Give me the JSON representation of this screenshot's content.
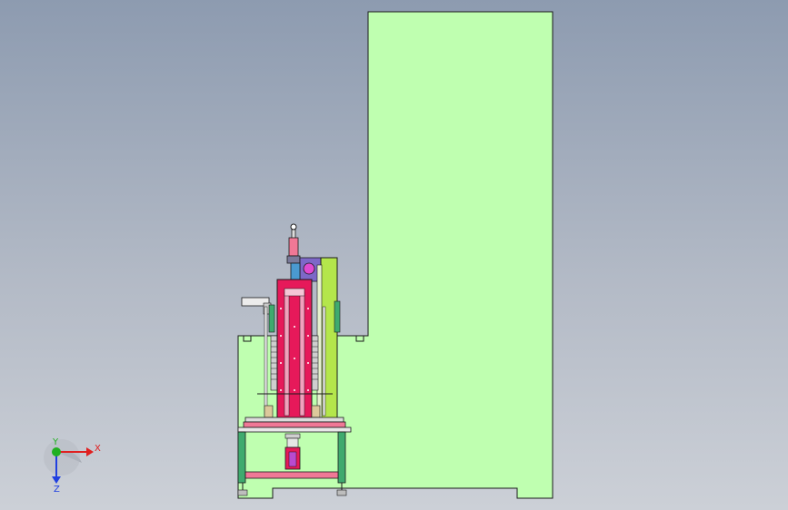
{
  "colors": {
    "body_fill": "#bfffb0",
    "outline": "#1a1a1a",
    "crimson": "#e6195a",
    "frame_green": "#3faa6e",
    "lime": "#b4e64b",
    "pink": "#f07896",
    "tan": "#dcc89b",
    "axis_x": "#e02020",
    "axis_y": "#20b020",
    "axis_z": "#2040e0"
  },
  "triad": {
    "x_label": "X",
    "y_label": "Y",
    "z_label": "Z"
  }
}
